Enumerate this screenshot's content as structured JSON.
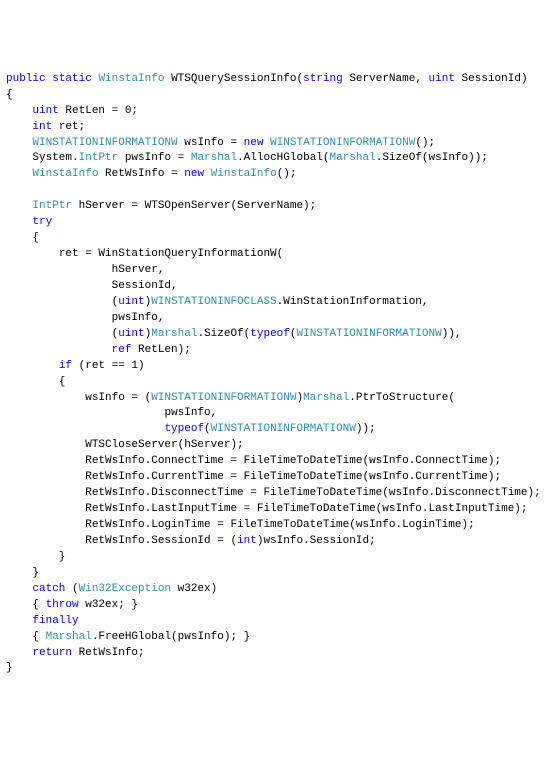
{
  "code": {
    "sig_kw_public": "public",
    "sig_kw_static": "static",
    "sig_type_ret": "WinstaInfo",
    "sig_method": "WTSQuerySessionInfo",
    "sig_kw_string": "string",
    "sig_param1": "ServerName",
    "sig_kw_uint": "uint",
    "sig_param2": "SessionId",
    "l1_kw_uint": "uint",
    "l1_var": "RetLen = 0;",
    "l2_kw_int": "int",
    "l2_var": "ret;",
    "l3_type": "WINSTATIONINFORMATIONW",
    "l3_var": "wsInfo = ",
    "l3_kw_new": "new",
    "l3_ctor": "WINSTATIONINFORMATIONW",
    "l3_end": "();",
    "l4_ns": "System.",
    "l4_type": "IntPtr",
    "l4_var": " pwsInfo = ",
    "l4_cls": "Marshal",
    "l4_call": ".AllocHGlobal(",
    "l4_cls2": "Marshal",
    "l4_call2": ".SizeOf(wsInfo));",
    "l5_type": "WinstaInfo",
    "l5_var": " RetWsInfo = ",
    "l5_kw_new": "new",
    "l5_ctor": "WinstaInfo",
    "l5_end": "();",
    "l6_type": "IntPtr",
    "l6_var": " hServer = WTSOpenServer(ServerName);",
    "l7_kw_try": "try",
    "l8": "ret = WinStationQueryInformationW(",
    "l9": "hServer,",
    "l10": "SessionId,",
    "l11_cast_open": "(",
    "l11_kw_uint": "uint",
    "l11_cast_close": ")",
    "l11_enum": "WINSTATIONINFOCLASS",
    "l11_member": ".WinStationInformation,",
    "l12": "pwsInfo,",
    "l13_cast_open": "(",
    "l13_kw_uint": "uint",
    "l13_cast_close": ")",
    "l13_cls": "Marshal",
    "l13_call": ".SizeOf(",
    "l13_kw_typeof": "typeof",
    "l13_paren": "(",
    "l13_type": "WINSTATIONINFORMATIONW",
    "l13_end": ")),",
    "l14_kw_ref": "ref",
    "l14_var": " RetLen);",
    "l15_kw_if": "if",
    "l15_cond": " (ret == 1)",
    "l16a": "wsInfo = (",
    "l16_type": "WINSTATIONINFORMATIONW",
    "l16b": ")",
    "l16_cls": "Marshal",
    "l16c": ".PtrToStructure(",
    "l17": "pwsInfo,",
    "l18_kw_typeof": "typeof",
    "l18_paren": "(",
    "l18_type": "WINSTATIONINFORMATIONW",
    "l18_end": "));",
    "l19": "WTSCloseServer(hServer);",
    "l20": "RetWsInfo.ConnectTime = FileTimeToDateTime(wsInfo.ConnectTime);",
    "l21": "RetWsInfo.CurrentTime = FileTimeToDateTime(wsInfo.CurrentTime);",
    "l22": "RetWsInfo.DisconnectTime = FileTimeToDateTime(wsInfo.DisconnectTime);",
    "l23": "RetWsInfo.LastInputTime = FileTimeToDateTime(wsInfo.LastInputTime);",
    "l24": "RetWsInfo.LoginTime = FileTimeToDateTime(wsInfo.LoginTime);",
    "l25a": "RetWsInfo.SessionId = (",
    "l25_kw_int": "int",
    "l25b": ")wsInfo.SessionId;",
    "l26_kw_catch": "catch",
    "l26_paren": " (",
    "l26_type": "Win32Exception",
    "l26_var": " w32ex)",
    "l27a": "{ ",
    "l27_kw_throw": "throw",
    "l27b": " w32ex; }",
    "l28_kw_finally": "finally",
    "l29a": "{ ",
    "l29_cls": "Marshal",
    "l29b": ".FreeHGlobal(pwsInfo); }",
    "l30_kw_return": "return",
    "l30_var": " RetWsInfo;"
  }
}
